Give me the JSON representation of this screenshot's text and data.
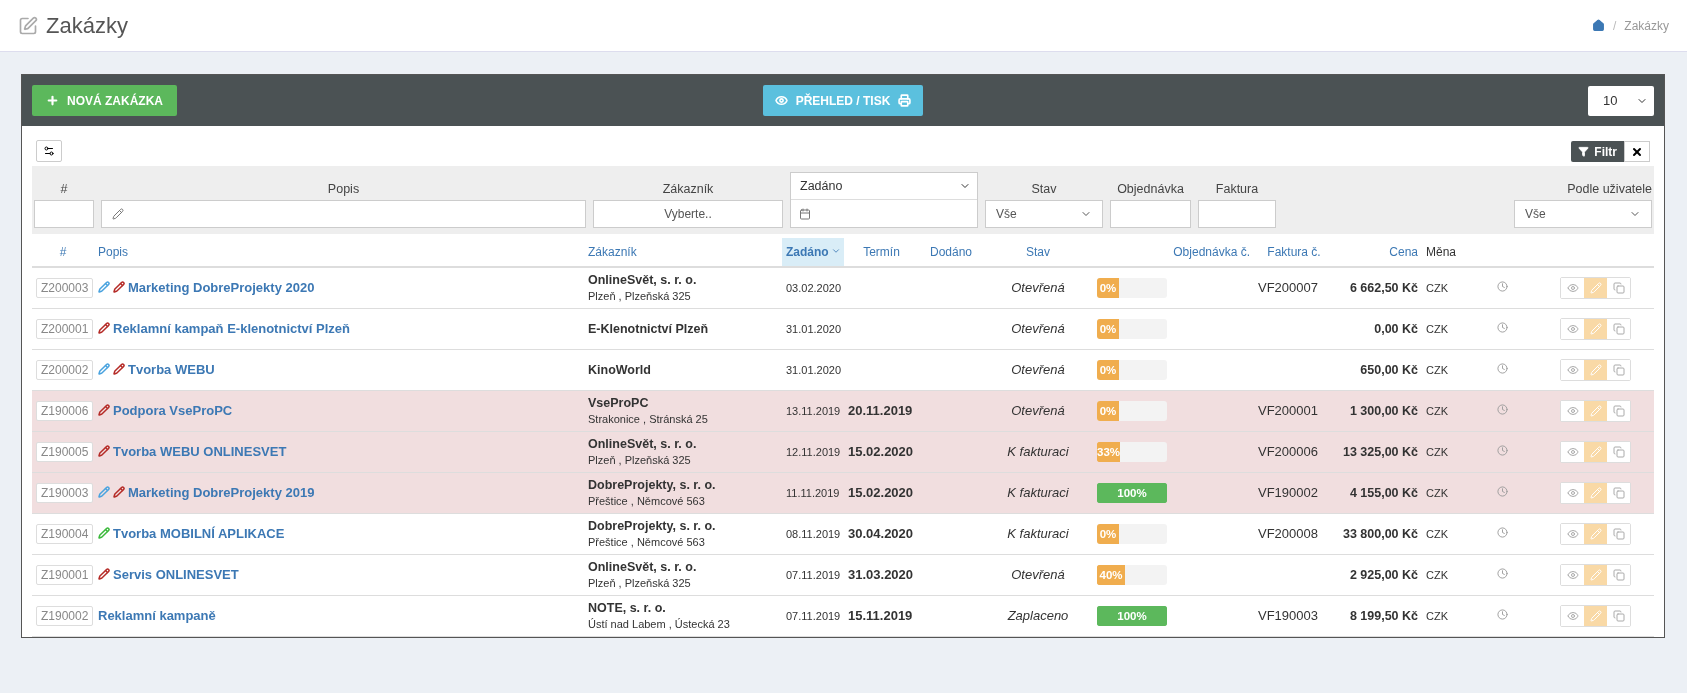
{
  "page": {
    "title": "Zakázky",
    "breadcrumb_separator": "/",
    "breadcrumb": [
      "Zakázky"
    ]
  },
  "toolbar": {
    "new_button": "NOVÁ ZAKÁZKA",
    "overview_button": "PŘEHLED / TISK",
    "page_size": "10"
  },
  "filter_button": "Filtr",
  "filters": [
    {
      "kind": "text",
      "label": "#"
    },
    {
      "kind": "edit",
      "label": "Popis"
    },
    {
      "kind": "picker",
      "label": "Zákazník",
      "placeholder": "Vyberte.."
    },
    {
      "kind": "date",
      "value": "Zadáno"
    },
    {
      "kind": "select",
      "label": "Stav",
      "value": "Vše"
    },
    {
      "kind": "text",
      "label": "Objednávka"
    },
    {
      "kind": "text",
      "label": "Faktura"
    },
    {
      "kind": "select",
      "label": "Podle uživatele",
      "value": "Vše"
    }
  ],
  "columns": [
    {
      "label": "#",
      "kind": "link",
      "sorted": false
    },
    {
      "label": "Popis",
      "kind": "link",
      "sorted": false
    },
    {
      "label": "Zákazník",
      "kind": "link",
      "sorted": false
    },
    {
      "label": "Zadáno",
      "kind": "link",
      "sorted": true
    },
    {
      "label": "Termín",
      "kind": "link",
      "sorted": false
    },
    {
      "label": "Dodáno",
      "kind": "link",
      "sorted": false
    },
    {
      "label": "Stav",
      "kind": "link",
      "sorted": false
    },
    {
      "label": "Objednávka č.",
      "kind": "link",
      "sorted": false
    },
    {
      "label": "Faktura č.",
      "kind": "link",
      "sorted": false
    },
    {
      "label": "Cena",
      "kind": "link",
      "sorted": false
    },
    {
      "label": "Měna",
      "kind": "plain",
      "sorted": false
    }
  ],
  "rows": [
    {
      "id": "Z200003",
      "marks": [
        {
          "color": "#4aa3df"
        },
        {
          "color": "#b52b27"
        }
      ],
      "title": "Marketing DobreProjekty 2020",
      "customer": "OnlineSvět, s. r. o.",
      "address": "Plzeň , Plzeňská 325",
      "ordered": "03.02.2020",
      "status": "Otevřená",
      "progress": "0%",
      "level": 0,
      "invoice": "VF200007",
      "price": "6 662,50 Kč",
      "currency": "CZK",
      "highlighted": false
    },
    {
      "id": "Z200001",
      "marks": [
        {
          "color": "#b52b27"
        }
      ],
      "title": "Reklamní kampaň E-klenotnictví Plzeň",
      "customer": "E-Klenotnictví Plzeň",
      "ordered": "31.01.2020",
      "status": "Otevřená",
      "progress": "0%",
      "level": 0,
      "price": "0,00 Kč",
      "currency": "CZK",
      "highlighted": false
    },
    {
      "id": "Z200002",
      "marks": [
        {
          "color": "#4aa3df"
        },
        {
          "color": "#b52b27"
        }
      ],
      "title": "Tvorba WEBU",
      "customer": "KinoWorld",
      "ordered": "31.01.2020",
      "status": "Otevřená",
      "progress": "0%",
      "level": 0,
      "price": "650,00 Kč",
      "currency": "CZK",
      "highlighted": false
    },
    {
      "id": "Z190006",
      "marks": [
        {
          "color": "#b52b27"
        }
      ],
      "title": "Podpora VseProPC",
      "customer": "VseProPC",
      "address": "Strakonice , Stránská 25",
      "ordered": "13.11.2019",
      "deadline": "20.11.2019",
      "status": "Otevřená",
      "progress": "0%",
      "level": 0,
      "invoice": "VF200001",
      "price": "1 300,00 Kč",
      "currency": "CZK",
      "highlighted": true
    },
    {
      "id": "Z190005",
      "marks": [
        {
          "color": "#b52b27"
        }
      ],
      "title": "Tvorba WEBU ONLINESVET",
      "customer": "OnlineSvět, s. r. o.",
      "address": "Plzeň , Plzeňská 325",
      "ordered": "12.11.2019",
      "deadline": "15.02.2020",
      "status": "K fakturaci",
      "progress": "33%",
      "level": 0.33,
      "invoice": "VF200006",
      "price": "13 325,00 Kč",
      "currency": "CZK",
      "highlighted": true
    },
    {
      "id": "Z190003",
      "marks": [
        {
          "color": "#4aa3df"
        },
        {
          "color": "#b52b27"
        }
      ],
      "title": "Marketing DobreProjekty 2019",
      "customer": "DobreProjekty, s. r. o.",
      "address": "Přeštice , Němcové 563",
      "ordered": "11.11.2019",
      "deadline": "15.02.2020",
      "status": "K fakturaci",
      "progress": "100%",
      "level": 1,
      "invoice": "VF190002",
      "price": "4 155,00 Kč",
      "currency": "CZK",
      "highlighted": true
    },
    {
      "id": "Z190004",
      "marks": [
        {
          "color": "#3cb93c"
        }
      ],
      "title": "Tvorba MOBILNÍ APLIKACE",
      "customer": "DobreProjekty, s. r. o.",
      "address": "Přeštice , Němcové 563",
      "ordered": "08.11.2019",
      "deadline": "30.04.2020",
      "status": "K fakturaci",
      "progress": "0%",
      "level": 0,
      "invoice": "VF200008",
      "price": "33 800,00 Kč",
      "currency": "CZK",
      "highlighted": false
    },
    {
      "id": "Z190001",
      "marks": [
        {
          "color": "#b52b27"
        }
      ],
      "title": "Servis ONLINESVET",
      "customer": "OnlineSvět, s. r. o.",
      "address": "Plzeň , Plzeňská 325",
      "ordered": "07.11.2019",
      "deadline": "31.03.2020",
      "status": "Otevřená",
      "progress": "40%",
      "level": 0.4,
      "price": "2 925,00 Kč",
      "currency": "CZK",
      "highlighted": false
    },
    {
      "id": "Z190002",
      "marks": [],
      "title": "Reklamní kampaně",
      "customer": "NOTE, s. r. o.",
      "address": "Ústí nad Labem , Ústecká 23",
      "ordered": "07.11.2019",
      "deadline": "15.11.2019",
      "status": "Zaplaceno",
      "progress": "100%",
      "level": 1,
      "invoice": "VF190003",
      "price": "8 199,50 Kč",
      "currency": "CZK",
      "highlighted": false
    }
  ]
}
